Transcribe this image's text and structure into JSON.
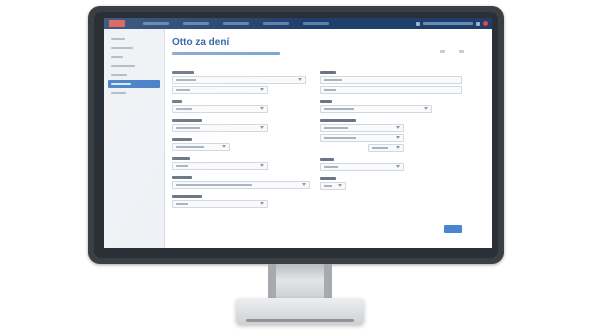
{
  "window": {
    "title": "Otto za dení"
  },
  "colors": {
    "topbar": "#1f3f6b",
    "accent": "#3a78c4",
    "title": "#2a5e9e",
    "alert": "#e04646"
  },
  "icons": [
    "logo-icon",
    "notification-icon",
    "settings-icon",
    "close-icon",
    "chevron-down-icon"
  ]
}
